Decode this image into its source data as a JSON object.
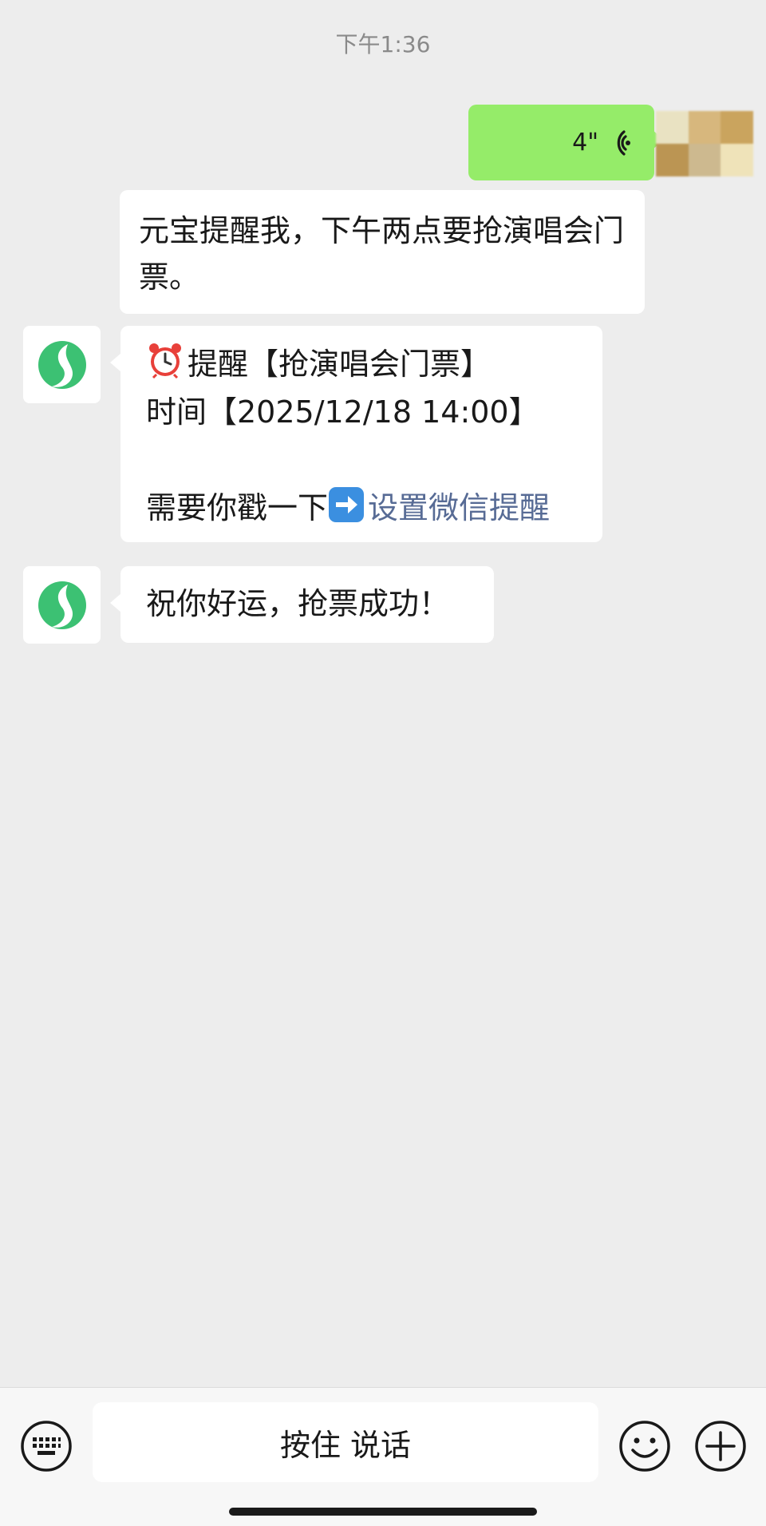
{
  "chat": {
    "timestamp": "下午1:36",
    "voice_message": {
      "duration": "4\""
    },
    "transcript": {
      "text": "元宝提醒我，下午两点要抢演唱会门票。"
    },
    "reminder": {
      "line1_emoji": "alarm-clock-icon",
      "line1_text": "提醒【抢演唱会门票】",
      "line2_text": "时间【2025/12/18 14:00】",
      "line3_text": "需要你戳一下",
      "line3_emoji": "right-arrow-icon",
      "link_text": "设置微信提醒"
    },
    "wish": {
      "text": "祝你好运，抢票成功！"
    }
  },
  "input_bar": {
    "hold_to_talk_label": "按住 说话",
    "keyboard_icon": "keyboard-icon",
    "emoji_icon": "emoji-icon",
    "more_icon": "plus-icon"
  },
  "colors": {
    "background": "#ededed",
    "outgoing_bubble": "#95ec69",
    "incoming_bubble": "#ffffff",
    "link": "#576b95",
    "bot_logo": "#3cc173"
  }
}
